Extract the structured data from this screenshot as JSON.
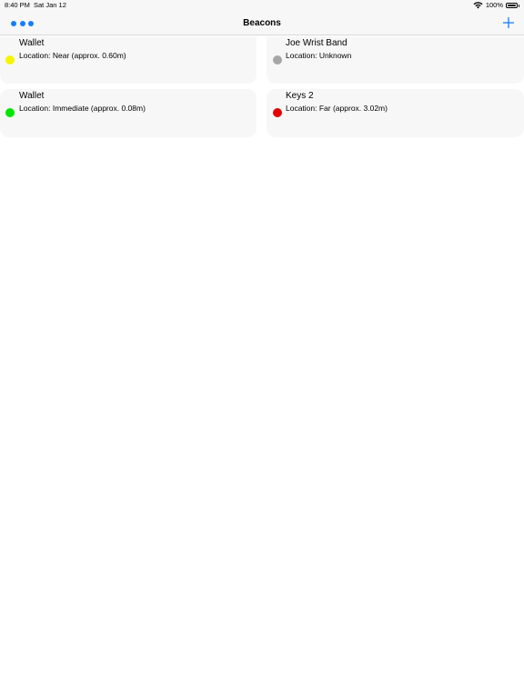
{
  "status_bar": {
    "time": "8:40 PM",
    "date": "Sat Jan 12",
    "battery_percent": "100%",
    "battery_level": 1.0,
    "icons": [
      "wifi-icon",
      "battery-icon"
    ]
  },
  "nav": {
    "title": "Beacons",
    "left_icon": "more-icon",
    "right_icon": "add-icon"
  },
  "colors": {
    "accent": "#157efb",
    "near": "#f5f500",
    "unknown": "#a6a6a6",
    "immediate": "#00e600",
    "far": "#e60000",
    "card_background": "#f7f7f7"
  },
  "beacons": [
    {
      "name": "Wallet",
      "location": "Location: Near (approx. 0.60m)",
      "status": "near",
      "color": "#f5f500"
    },
    {
      "name": "Joe Wrist Band",
      "location": "Location: Unknown",
      "status": "unknown",
      "color": "#a6a6a6"
    },
    {
      "name": "Wallet",
      "location": "Location: Immediate (approx. 0.08m)",
      "status": "immediate",
      "color": "#00e600"
    },
    {
      "name": "Keys 2",
      "location": "Location: Far (approx. 3.02m)",
      "status": "far",
      "color": "#e60000"
    }
  ]
}
